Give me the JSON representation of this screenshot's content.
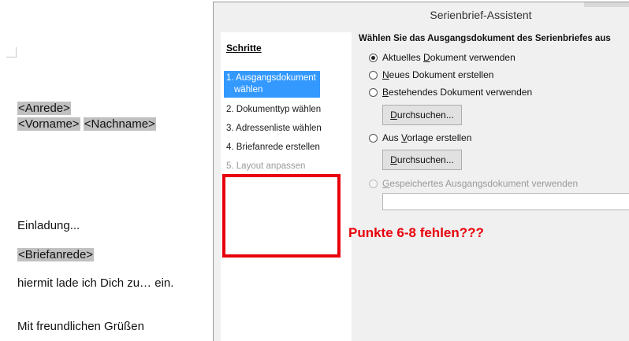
{
  "document": {
    "anrede": "<Anrede>",
    "vorname": "<Vorname>",
    "nachname": "<Nachname>",
    "einladung": "Einladung...",
    "briefanrede": "<Briefanrede>",
    "body": "hiermit lade ich Dich zu… ein.",
    "closing": "Mit freundlichen Grüßen"
  },
  "dialog": {
    "title": "Serienbrief-Assistent",
    "steps_heading": "Schritte",
    "steps": [
      {
        "line1": "1. Ausgangsdokument",
        "line2": "wählen"
      },
      {
        "label": "2. Dokumenttyp wählen"
      },
      {
        "label": "3. Adressenliste wählen"
      },
      {
        "label": "4. Briefanrede erstellen"
      },
      {
        "label": "5. Layout anpassen"
      }
    ],
    "main_heading": "Wählen Sie das Ausgangsdokument des Serienbriefes aus",
    "options": {
      "current": {
        "underline": "D",
        "before": "Aktuelles ",
        "after": "okument verwenden"
      },
      "new": {
        "underline": "N",
        "before": "",
        "after": "eues Dokument erstellen"
      },
      "existing": {
        "underline": "B",
        "before": "",
        "after": "estehendes Dokument verwenden"
      },
      "template": {
        "underline": "V",
        "before": "Aus ",
        "after": "orlage erstellen"
      },
      "saved": {
        "underline": "G",
        "before": "",
        "after": "espeichertes Ausgangsdokument verwenden"
      }
    },
    "browse_button": {
      "underline": "D",
      "after": "urchsuchen..."
    }
  },
  "annotation": {
    "text": "Punkte 6-8 fehlen???"
  }
}
